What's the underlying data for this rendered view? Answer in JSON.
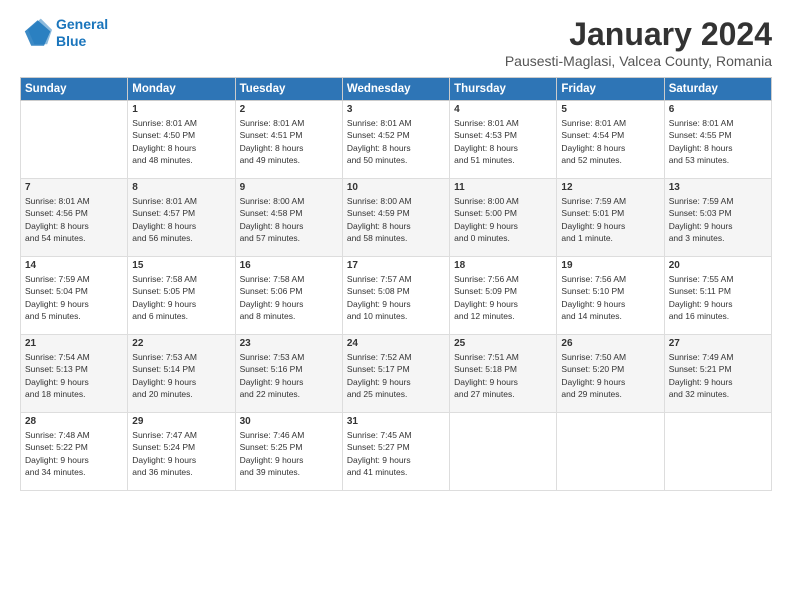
{
  "logo": {
    "line1": "General",
    "line2": "Blue"
  },
  "title": "January 2024",
  "subtitle": "Pausesti-Maglasi, Valcea County, Romania",
  "headers": [
    "Sunday",
    "Monday",
    "Tuesday",
    "Wednesday",
    "Thursday",
    "Friday",
    "Saturday"
  ],
  "weeks": [
    [
      {
        "day": "",
        "info": ""
      },
      {
        "day": "1",
        "info": "Sunrise: 8:01 AM\nSunset: 4:50 PM\nDaylight: 8 hours\nand 48 minutes."
      },
      {
        "day": "2",
        "info": "Sunrise: 8:01 AM\nSunset: 4:51 PM\nDaylight: 8 hours\nand 49 minutes."
      },
      {
        "day": "3",
        "info": "Sunrise: 8:01 AM\nSunset: 4:52 PM\nDaylight: 8 hours\nand 50 minutes."
      },
      {
        "day": "4",
        "info": "Sunrise: 8:01 AM\nSunset: 4:53 PM\nDaylight: 8 hours\nand 51 minutes."
      },
      {
        "day": "5",
        "info": "Sunrise: 8:01 AM\nSunset: 4:54 PM\nDaylight: 8 hours\nand 52 minutes."
      },
      {
        "day": "6",
        "info": "Sunrise: 8:01 AM\nSunset: 4:55 PM\nDaylight: 8 hours\nand 53 minutes."
      }
    ],
    [
      {
        "day": "7",
        "info": "Sunrise: 8:01 AM\nSunset: 4:56 PM\nDaylight: 8 hours\nand 54 minutes."
      },
      {
        "day": "8",
        "info": "Sunrise: 8:01 AM\nSunset: 4:57 PM\nDaylight: 8 hours\nand 56 minutes."
      },
      {
        "day": "9",
        "info": "Sunrise: 8:00 AM\nSunset: 4:58 PM\nDaylight: 8 hours\nand 57 minutes."
      },
      {
        "day": "10",
        "info": "Sunrise: 8:00 AM\nSunset: 4:59 PM\nDaylight: 8 hours\nand 58 minutes."
      },
      {
        "day": "11",
        "info": "Sunrise: 8:00 AM\nSunset: 5:00 PM\nDaylight: 9 hours\nand 0 minutes."
      },
      {
        "day": "12",
        "info": "Sunrise: 7:59 AM\nSunset: 5:01 PM\nDaylight: 9 hours\nand 1 minute."
      },
      {
        "day": "13",
        "info": "Sunrise: 7:59 AM\nSunset: 5:03 PM\nDaylight: 9 hours\nand 3 minutes."
      }
    ],
    [
      {
        "day": "14",
        "info": "Sunrise: 7:59 AM\nSunset: 5:04 PM\nDaylight: 9 hours\nand 5 minutes."
      },
      {
        "day": "15",
        "info": "Sunrise: 7:58 AM\nSunset: 5:05 PM\nDaylight: 9 hours\nand 6 minutes."
      },
      {
        "day": "16",
        "info": "Sunrise: 7:58 AM\nSunset: 5:06 PM\nDaylight: 9 hours\nand 8 minutes."
      },
      {
        "day": "17",
        "info": "Sunrise: 7:57 AM\nSunset: 5:08 PM\nDaylight: 9 hours\nand 10 minutes."
      },
      {
        "day": "18",
        "info": "Sunrise: 7:56 AM\nSunset: 5:09 PM\nDaylight: 9 hours\nand 12 minutes."
      },
      {
        "day": "19",
        "info": "Sunrise: 7:56 AM\nSunset: 5:10 PM\nDaylight: 9 hours\nand 14 minutes."
      },
      {
        "day": "20",
        "info": "Sunrise: 7:55 AM\nSunset: 5:11 PM\nDaylight: 9 hours\nand 16 minutes."
      }
    ],
    [
      {
        "day": "21",
        "info": "Sunrise: 7:54 AM\nSunset: 5:13 PM\nDaylight: 9 hours\nand 18 minutes."
      },
      {
        "day": "22",
        "info": "Sunrise: 7:53 AM\nSunset: 5:14 PM\nDaylight: 9 hours\nand 20 minutes."
      },
      {
        "day": "23",
        "info": "Sunrise: 7:53 AM\nSunset: 5:16 PM\nDaylight: 9 hours\nand 22 minutes."
      },
      {
        "day": "24",
        "info": "Sunrise: 7:52 AM\nSunset: 5:17 PM\nDaylight: 9 hours\nand 25 minutes."
      },
      {
        "day": "25",
        "info": "Sunrise: 7:51 AM\nSunset: 5:18 PM\nDaylight: 9 hours\nand 27 minutes."
      },
      {
        "day": "26",
        "info": "Sunrise: 7:50 AM\nSunset: 5:20 PM\nDaylight: 9 hours\nand 29 minutes."
      },
      {
        "day": "27",
        "info": "Sunrise: 7:49 AM\nSunset: 5:21 PM\nDaylight: 9 hours\nand 32 minutes."
      }
    ],
    [
      {
        "day": "28",
        "info": "Sunrise: 7:48 AM\nSunset: 5:22 PM\nDaylight: 9 hours\nand 34 minutes."
      },
      {
        "day": "29",
        "info": "Sunrise: 7:47 AM\nSunset: 5:24 PM\nDaylight: 9 hours\nand 36 minutes."
      },
      {
        "day": "30",
        "info": "Sunrise: 7:46 AM\nSunset: 5:25 PM\nDaylight: 9 hours\nand 39 minutes."
      },
      {
        "day": "31",
        "info": "Sunrise: 7:45 AM\nSunset: 5:27 PM\nDaylight: 9 hours\nand 41 minutes."
      },
      {
        "day": "",
        "info": ""
      },
      {
        "day": "",
        "info": ""
      },
      {
        "day": "",
        "info": ""
      }
    ]
  ]
}
